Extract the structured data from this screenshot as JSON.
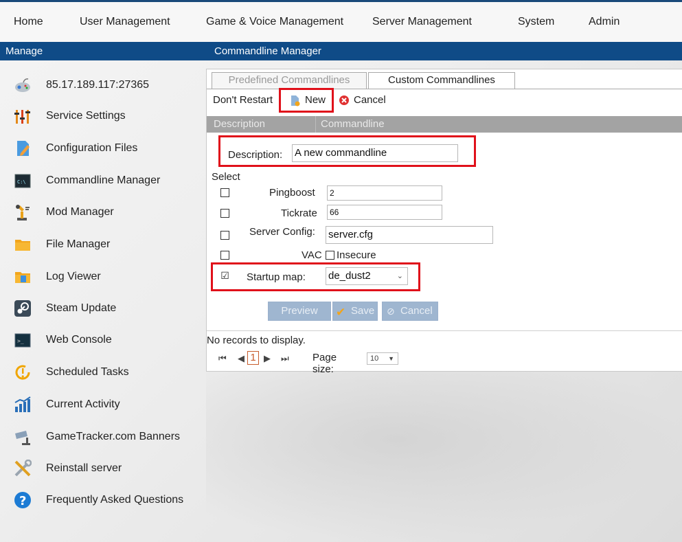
{
  "nav": [
    "Home",
    "User Management",
    "Game & Voice Management",
    "Server Management",
    "System",
    "Admin"
  ],
  "headers": {
    "left": "Manage",
    "right": "Commandline Manager"
  },
  "sidebar": [
    {
      "label": "85.17.189.117:27365",
      "icon": "gamepad-icon"
    },
    {
      "label": "Service Settings",
      "icon": "sliders-icon"
    },
    {
      "label": "Configuration Files",
      "icon": "file-edit-icon"
    },
    {
      "label": "Commandline Manager",
      "icon": "terminal-icon"
    },
    {
      "label": "Mod Manager",
      "icon": "robot-arm-icon"
    },
    {
      "label": "File Manager",
      "icon": "folder-icon"
    },
    {
      "label": "Log Viewer",
      "icon": "log-folder-icon"
    },
    {
      "label": "Steam Update",
      "icon": "steam-icon"
    },
    {
      "label": "Web Console",
      "icon": "console-icon"
    },
    {
      "label": "Scheduled Tasks",
      "icon": "clock-icon"
    },
    {
      "label": "Current Activity",
      "icon": "chart-icon"
    },
    {
      "label": "GameTracker.com Banners",
      "icon": "camera-icon"
    },
    {
      "label": "Reinstall server",
      "icon": "tools-icon"
    },
    {
      "label": "Frequently Asked Questions",
      "icon": "help-icon"
    }
  ],
  "tabs": {
    "predefined": "Predefined Commandlines",
    "custom": "Custom Commandlines"
  },
  "toolbar": {
    "dont_restart": "Don't Restart",
    "new": "New",
    "cancel": "Cancel"
  },
  "grid": {
    "col_description": "Description",
    "col_commandline": "Commandline"
  },
  "form": {
    "description_label": "Description:",
    "description_value": "A new commandline",
    "select_label": "Select",
    "pingboost_label": "Pingboost",
    "pingboost_value": "2",
    "tickrate_label": "Tickrate",
    "tickrate_value": "66",
    "server_config_label": "Server Config:",
    "server_config_value": "server.cfg",
    "vac_label": "VAC",
    "insecure_label": "Insecure",
    "startup_map_label": "Startup map:",
    "startup_map_value": "de_dust2",
    "startup_map_checked": "☑"
  },
  "buttons": {
    "preview": "Preview",
    "save": "Save",
    "cancel": "Cancel"
  },
  "footer": {
    "no_records": "No records to display.",
    "page_number": "1",
    "page_size_label": "Page size:",
    "page_size_value": "10"
  },
  "colors": {
    "header_blue": "#0f4b87",
    "highlight_red": "#e0101a"
  }
}
